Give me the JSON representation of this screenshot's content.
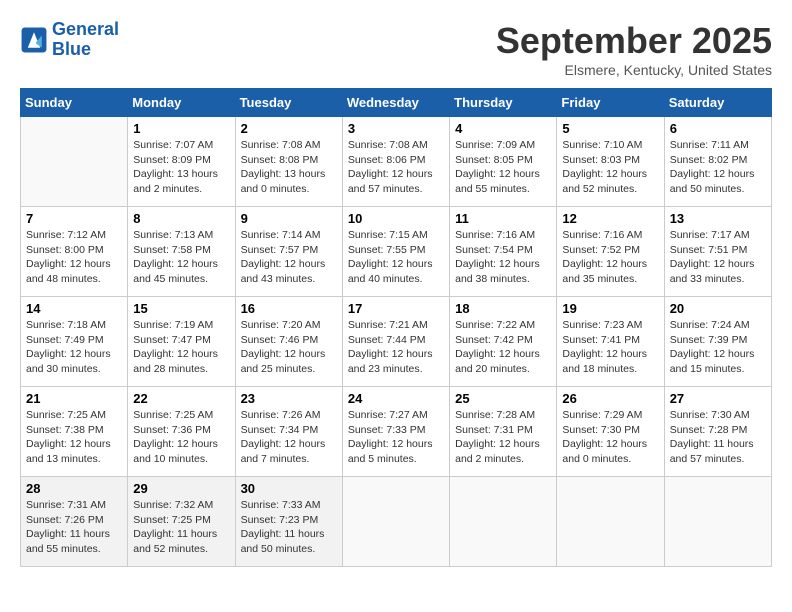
{
  "logo": {
    "line1": "General",
    "line2": "Blue"
  },
  "title": "September 2025",
  "subtitle": "Elsmere, Kentucky, United States",
  "days_of_week": [
    "Sunday",
    "Monday",
    "Tuesday",
    "Wednesday",
    "Thursday",
    "Friday",
    "Saturday"
  ],
  "weeks": [
    [
      {
        "day": "",
        "info": ""
      },
      {
        "day": "1",
        "info": "Sunrise: 7:07 AM\nSunset: 8:09 PM\nDaylight: 13 hours\nand 2 minutes."
      },
      {
        "day": "2",
        "info": "Sunrise: 7:08 AM\nSunset: 8:08 PM\nDaylight: 13 hours\nand 0 minutes."
      },
      {
        "day": "3",
        "info": "Sunrise: 7:08 AM\nSunset: 8:06 PM\nDaylight: 12 hours\nand 57 minutes."
      },
      {
        "day": "4",
        "info": "Sunrise: 7:09 AM\nSunset: 8:05 PM\nDaylight: 12 hours\nand 55 minutes."
      },
      {
        "day": "5",
        "info": "Sunrise: 7:10 AM\nSunset: 8:03 PM\nDaylight: 12 hours\nand 52 minutes."
      },
      {
        "day": "6",
        "info": "Sunrise: 7:11 AM\nSunset: 8:02 PM\nDaylight: 12 hours\nand 50 minutes."
      }
    ],
    [
      {
        "day": "7",
        "info": "Sunrise: 7:12 AM\nSunset: 8:00 PM\nDaylight: 12 hours\nand 48 minutes."
      },
      {
        "day": "8",
        "info": "Sunrise: 7:13 AM\nSunset: 7:58 PM\nDaylight: 12 hours\nand 45 minutes."
      },
      {
        "day": "9",
        "info": "Sunrise: 7:14 AM\nSunset: 7:57 PM\nDaylight: 12 hours\nand 43 minutes."
      },
      {
        "day": "10",
        "info": "Sunrise: 7:15 AM\nSunset: 7:55 PM\nDaylight: 12 hours\nand 40 minutes."
      },
      {
        "day": "11",
        "info": "Sunrise: 7:16 AM\nSunset: 7:54 PM\nDaylight: 12 hours\nand 38 minutes."
      },
      {
        "day": "12",
        "info": "Sunrise: 7:16 AM\nSunset: 7:52 PM\nDaylight: 12 hours\nand 35 minutes."
      },
      {
        "day": "13",
        "info": "Sunrise: 7:17 AM\nSunset: 7:51 PM\nDaylight: 12 hours\nand 33 minutes."
      }
    ],
    [
      {
        "day": "14",
        "info": "Sunrise: 7:18 AM\nSunset: 7:49 PM\nDaylight: 12 hours\nand 30 minutes."
      },
      {
        "day": "15",
        "info": "Sunrise: 7:19 AM\nSunset: 7:47 PM\nDaylight: 12 hours\nand 28 minutes."
      },
      {
        "day": "16",
        "info": "Sunrise: 7:20 AM\nSunset: 7:46 PM\nDaylight: 12 hours\nand 25 minutes."
      },
      {
        "day": "17",
        "info": "Sunrise: 7:21 AM\nSunset: 7:44 PM\nDaylight: 12 hours\nand 23 minutes."
      },
      {
        "day": "18",
        "info": "Sunrise: 7:22 AM\nSunset: 7:42 PM\nDaylight: 12 hours\nand 20 minutes."
      },
      {
        "day": "19",
        "info": "Sunrise: 7:23 AM\nSunset: 7:41 PM\nDaylight: 12 hours\nand 18 minutes."
      },
      {
        "day": "20",
        "info": "Sunrise: 7:24 AM\nSunset: 7:39 PM\nDaylight: 12 hours\nand 15 minutes."
      }
    ],
    [
      {
        "day": "21",
        "info": "Sunrise: 7:25 AM\nSunset: 7:38 PM\nDaylight: 12 hours\nand 13 minutes."
      },
      {
        "day": "22",
        "info": "Sunrise: 7:25 AM\nSunset: 7:36 PM\nDaylight: 12 hours\nand 10 minutes."
      },
      {
        "day": "23",
        "info": "Sunrise: 7:26 AM\nSunset: 7:34 PM\nDaylight: 12 hours\nand 7 minutes."
      },
      {
        "day": "24",
        "info": "Sunrise: 7:27 AM\nSunset: 7:33 PM\nDaylight: 12 hours\nand 5 minutes."
      },
      {
        "day": "25",
        "info": "Sunrise: 7:28 AM\nSunset: 7:31 PM\nDaylight: 12 hours\nand 2 minutes."
      },
      {
        "day": "26",
        "info": "Sunrise: 7:29 AM\nSunset: 7:30 PM\nDaylight: 12 hours\nand 0 minutes."
      },
      {
        "day": "27",
        "info": "Sunrise: 7:30 AM\nSunset: 7:28 PM\nDaylight: 11 hours\nand 57 minutes."
      }
    ],
    [
      {
        "day": "28",
        "info": "Sunrise: 7:31 AM\nSunset: 7:26 PM\nDaylight: 11 hours\nand 55 minutes."
      },
      {
        "day": "29",
        "info": "Sunrise: 7:32 AM\nSunset: 7:25 PM\nDaylight: 11 hours\nand 52 minutes."
      },
      {
        "day": "30",
        "info": "Sunrise: 7:33 AM\nSunset: 7:23 PM\nDaylight: 11 hours\nand 50 minutes."
      },
      {
        "day": "",
        "info": ""
      },
      {
        "day": "",
        "info": ""
      },
      {
        "day": "",
        "info": ""
      },
      {
        "day": "",
        "info": ""
      }
    ]
  ]
}
